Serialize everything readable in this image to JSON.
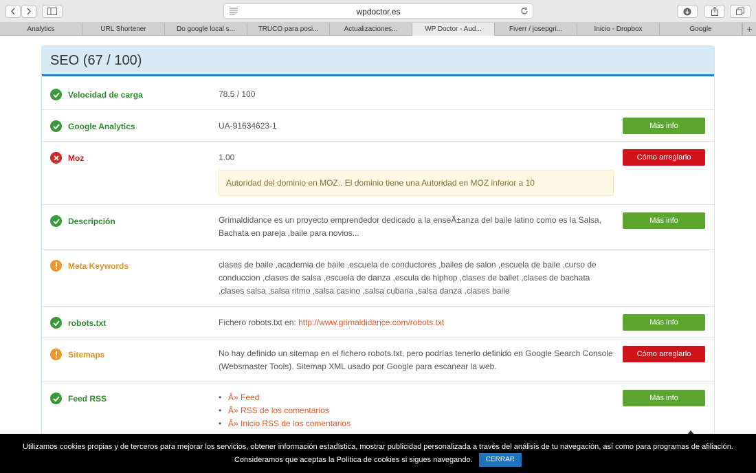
{
  "browser": {
    "url": "wpdoctor.es",
    "tabs": [
      "Analytics",
      "URL Shortener",
      "Do google local s...",
      "TRUCO para posi...",
      "Actualizaciones...",
      "WP Doctor - Aud...",
      "Fiverr / josepgri...",
      "Inicio - Dropbox",
      "Google"
    ],
    "active_tab": 5,
    "new_tab_symbol": "+"
  },
  "panel": {
    "title": "SEO (67 / 100)"
  },
  "rows": {
    "speed": {
      "label": "Velocidad de carga",
      "value": "78.5 / 100"
    },
    "ga": {
      "label": "Google Analytics",
      "value": "UA-91634623-1",
      "button": "Más info"
    },
    "moz": {
      "label": "Moz",
      "value": "1.00",
      "button": "Cómo arreglarlo",
      "alert": "Autoridad del dominio en MOZ.. El dominio tiene una Autoridad en MOZ inferior a 10"
    },
    "desc": {
      "label": "Descripción",
      "value": "Grimaldidance es un proyecto emprendedor dedicado a la enseÃ±anza del baile latino como es la Salsa, Bachata en pareja ,baile para novios...",
      "button": "Más info"
    },
    "keywords": {
      "label": "Meta Keywords",
      "value": "clases de baile ,academia de baile ,escuela de conductores ,bailes de salon ,escuela de baile ,curso de conduccion ,clases de salsa ,escuela de danza ,escula de hiphop ,clases de ballet ,clases de bachata ,clases salsa ,salsa ritmo ,salsa casino ,salsa cubana ,salsa danza ,clases baile"
    },
    "robots": {
      "label": "robots.txt",
      "prefix": "Fichero robots.txt en:",
      "link": "http://www.grimaldidance.com/robots.txt",
      "button": "Más info"
    },
    "sitemaps": {
      "label": "Sitemaps",
      "value": "No hay definido un sitemap en el fichero robots.txt, pero podrías tenerlo definido en Google Search Console (Websmaster Tools). Sitemap XML usado por Google para escanear la web.",
      "button": "Cómo arreglarlo"
    },
    "feed": {
      "label": "Feed RSS",
      "items": [
        "Â» Feed",
        "Â» RSS de los comentarios",
        "Â» Inicio RSS de los comentarios"
      ],
      "button": "Más info"
    }
  },
  "cookie": {
    "line1": "Utilizamos cookies propias y de terceros para mejorar los servicios, obtener información estadística, mostrar publicidad personalizada a través del análisis de tu navegación, así como para programas de afiliación.",
    "line2": "Consideramos que aceptas la Política de cookies si sigues navegando.",
    "button": "CERRAR"
  },
  "colors": {
    "ok": "#3a9a3a",
    "error": "#cc2b2b",
    "warning": "#f0962a",
    "accent": "#2a7ec3",
    "btn_green": "#5ca630",
    "btn_red": "#d0131b"
  }
}
